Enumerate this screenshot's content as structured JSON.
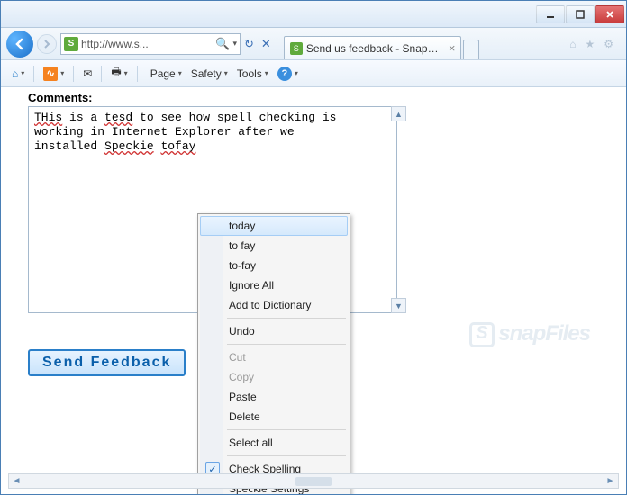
{
  "window": {
    "title": "Send us feedback - SnapFil..."
  },
  "address": {
    "url": "http://www.s...",
    "search_placeholder": ""
  },
  "tab": {
    "title": "Send us feedback - SnapFil..."
  },
  "toolbar": {
    "page": "Page",
    "safety": "Safety",
    "tools": "Tools"
  },
  "page": {
    "comments_label": "Comments:",
    "line1_pre": "",
    "w_this": "THis",
    "line1_mid": " is a ",
    "w_tesd": "tesd",
    "line1_post": " to see how spell checking is",
    "line2": "working in Internet Explorer after we",
    "line3_pre": "installed ",
    "w_speckie": "Speckie",
    "line3_mid": " ",
    "w_tofay": "tofay",
    "send_button": "Send Feedback",
    "watermark": "snapFiles"
  },
  "contextmenu": {
    "items": [
      {
        "label": "today",
        "highlight": true
      },
      {
        "label": "to fay"
      },
      {
        "label": "to-fay"
      },
      {
        "label": "Ignore All"
      },
      {
        "label": "Add to Dictionary"
      },
      {
        "sep": true
      },
      {
        "label": "Undo"
      },
      {
        "sep": true
      },
      {
        "label": "Cut",
        "disabled": true
      },
      {
        "label": "Copy",
        "disabled": true
      },
      {
        "label": "Paste"
      },
      {
        "label": "Delete"
      },
      {
        "sep": true
      },
      {
        "label": "Select all"
      },
      {
        "sep": true
      },
      {
        "label": "Check Spelling",
        "checked": true
      },
      {
        "label": "Speckie Settings"
      }
    ]
  }
}
